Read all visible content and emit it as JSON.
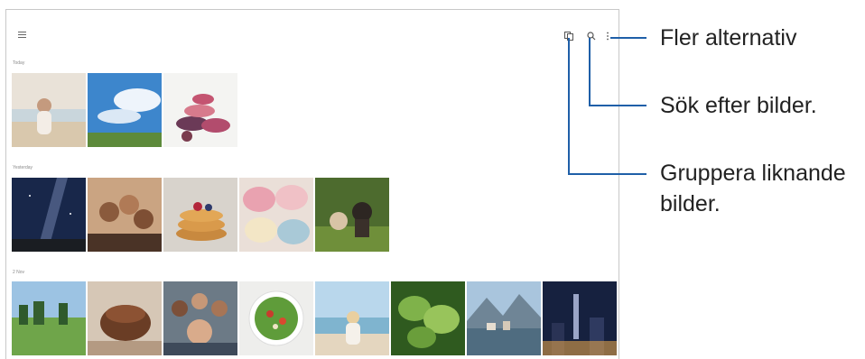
{
  "sections": [
    {
      "label": "Today",
      "photos": [
        "beach-girl-photo",
        "blue-sky-field-photo",
        "macaron-stack-photo"
      ]
    },
    {
      "label": "Yesterday",
      "photos": [
        "milky-way-photo",
        "group-selfie-photo",
        "pancakes-photo",
        "macarons-photo",
        "puppy-kitten-photo"
      ]
    },
    {
      "label": "2 Nov",
      "photos": [
        "green-meadow-photo",
        "chocolate-cake-photo",
        "friends-selfie-photo",
        "salad-bowl-photo",
        "beach-child-photo",
        "green-leaves-photo",
        "mountain-lake-village-photo",
        "night-city-photo"
      ]
    }
  ],
  "callouts": {
    "more_options": "Fler alternativ",
    "search": "Sök efter bilder.",
    "group_line1": "Gruppera liknande",
    "group_line2": "bilder."
  },
  "icons": {
    "menu": "hamburger-menu-icon",
    "group": "group-similar-icon",
    "search": "search-icon",
    "more": "more-options-icon"
  },
  "colors": {
    "callout_line": "#1f5fa8"
  }
}
